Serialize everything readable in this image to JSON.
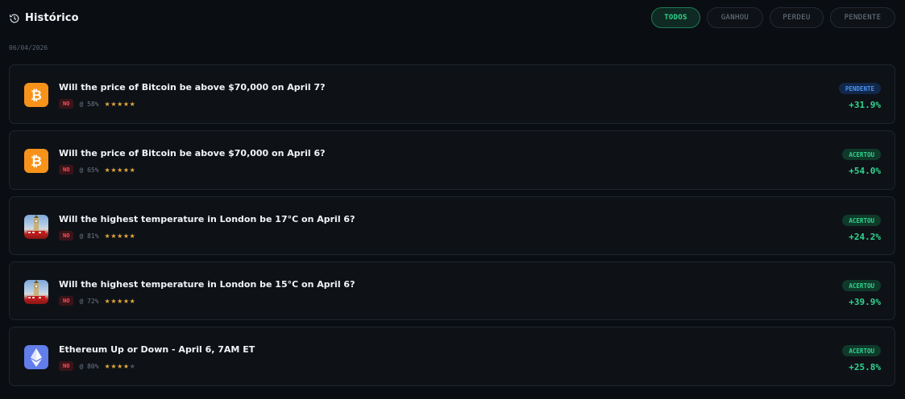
{
  "header": {
    "title": "Histórico",
    "icon": "history-icon",
    "filters": [
      {
        "label": "TODOS",
        "active": true
      },
      {
        "label": "GANHOU",
        "active": false
      },
      {
        "label": "PERDEU",
        "active": false
      },
      {
        "label": "PENDENTE",
        "active": false
      }
    ]
  },
  "date": "06/04/2026",
  "colors": {
    "accent_green": "#2fd58f",
    "pending_blue": "#4a93f0",
    "no_red": "#ff4d5e",
    "star_gold": "#e5a93b",
    "bitcoin_orange": "#f7931a",
    "ethereum_blue": "#627eea"
  },
  "trades": [
    {
      "icon": "bitcoin-icon",
      "question": "Will the price of Bitcoin be above $70,000 on April 7?",
      "side": "NO",
      "prob": "@ 58%",
      "stars": 5,
      "stars_max": 5,
      "status": "PENDENTE",
      "status_type": "pend",
      "pnl": "+31.9%"
    },
    {
      "icon": "bitcoin-icon",
      "question": "Will the price of Bitcoin be above $70,000 on April 6?",
      "side": "NO",
      "prob": "@ 65%",
      "stars": 5,
      "stars_max": 5,
      "status": "ACERTOU",
      "status_type": "win",
      "pnl": "+54.0%"
    },
    {
      "icon": "london-icon",
      "question": "Will the highest temperature in London be 17°C on April 6?",
      "side": "NO",
      "prob": "@ 81%",
      "stars": 5,
      "stars_max": 5,
      "status": "ACERTOU",
      "status_type": "win",
      "pnl": "+24.2%"
    },
    {
      "icon": "london-icon",
      "question": "Will the highest temperature in London be 15°C on April 6?",
      "side": "NO",
      "prob": "@ 72%",
      "stars": 5,
      "stars_max": 5,
      "status": "ACERTOU",
      "status_type": "win",
      "pnl": "+39.9%"
    },
    {
      "icon": "ethereum-icon",
      "question": "Ethereum Up or Down - April 6, 7AM ET",
      "side": "NO",
      "prob": "@ 80%",
      "stars": 4,
      "stars_max": 5,
      "status": "ACERTOU",
      "status_type": "win",
      "pnl": "+25.8%"
    }
  ]
}
